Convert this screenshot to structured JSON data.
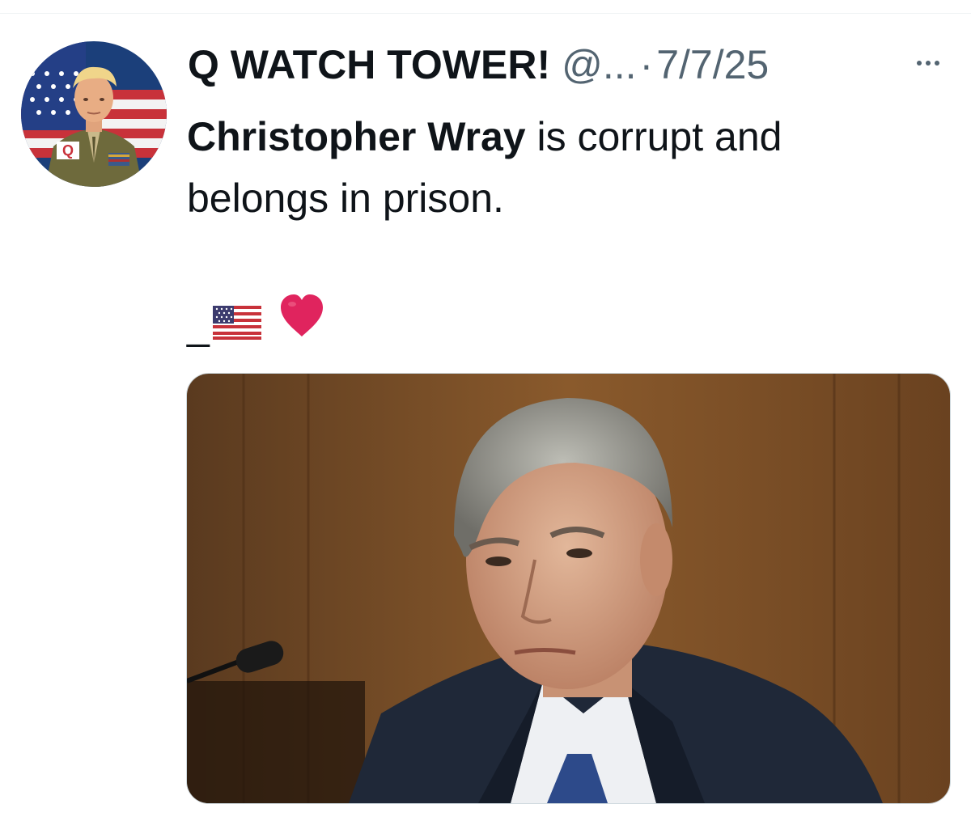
{
  "tweet": {
    "display_name": "Q WATCH TOWER!",
    "handle": "@...",
    "separator": "·",
    "date": "7/7/25",
    "text_bold": "Christopher Wray",
    "text_rest": " is corrupt and belongs in prison.",
    "emoji_prefix": "_"
  },
  "icons": {
    "more": "more-options-icon",
    "flag": "us-flag-emoji",
    "heart": "red-heart-emoji"
  },
  "colors": {
    "text_primary": "#0f1419",
    "text_secondary": "#536471",
    "heart": "#e0245e"
  }
}
